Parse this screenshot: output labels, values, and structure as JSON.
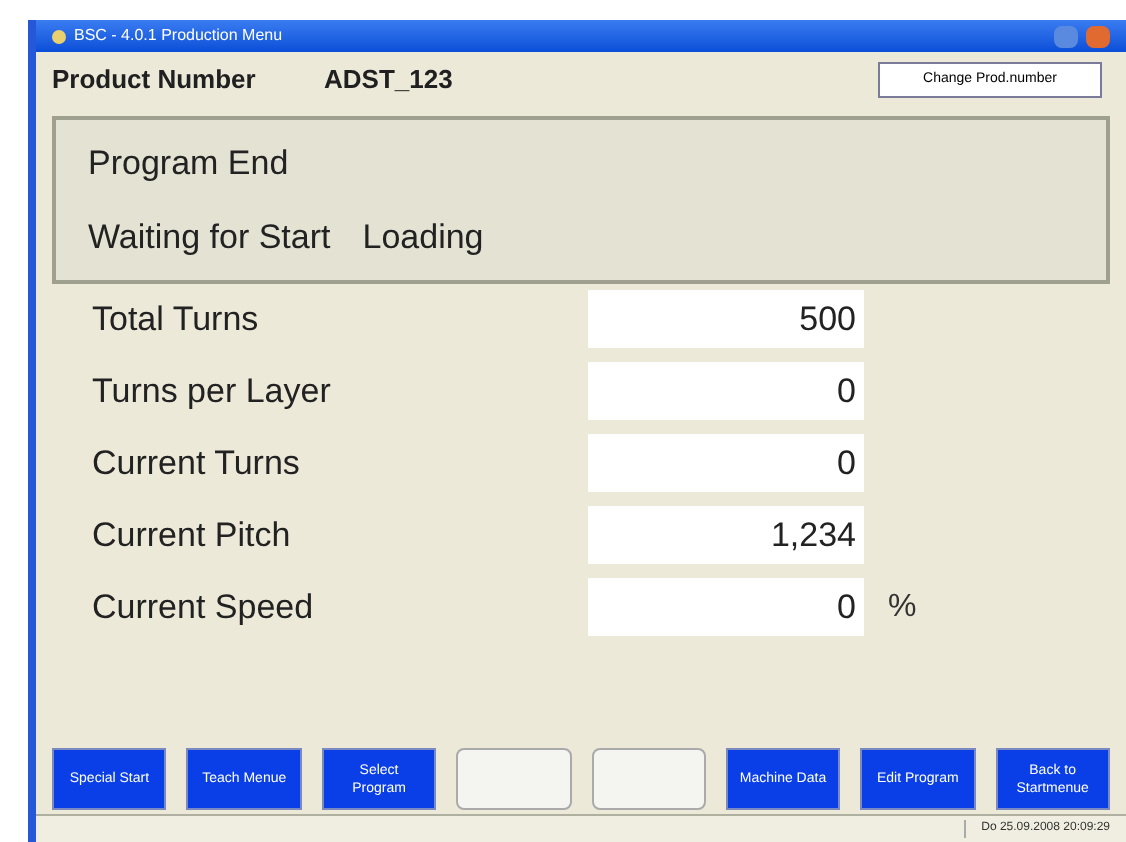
{
  "window": {
    "title": "BSC - 4.0.1 Production Menu"
  },
  "product": {
    "label": "Product Number",
    "value": "ADST_123",
    "button": "Change Prod.number"
  },
  "status_panel": {
    "lines": [
      {
        "texts": [
          "Program End"
        ]
      },
      {
        "texts": [
          "Waiting for Start",
          "Loading"
        ]
      }
    ]
  },
  "fields": [
    {
      "label": "Total Turns",
      "value": "500"
    },
    {
      "label": "Turns per Layer",
      "value": "0"
    },
    {
      "label": "Current Turns",
      "value": "0"
    },
    {
      "label": "Current Pitch",
      "value": "1,234"
    },
    {
      "label": "Current Speed",
      "value": "0",
      "unit": "%"
    }
  ],
  "buttons": [
    {
      "label": "Special Start",
      "disabled": false
    },
    {
      "label": "Teach Menue",
      "disabled": false
    },
    {
      "label": "Select Program",
      "disabled": false
    },
    {
      "disabled": true
    },
    {
      "disabled": true
    },
    {
      "label": "Machine Data",
      "disabled": false
    },
    {
      "label": "Edit Program",
      "disabled": false
    },
    {
      "label": "Back to Startmenue",
      "disabled": false
    }
  ],
  "status_bar": {
    "datetime": "Do 25.09.2008 20:09:29"
  }
}
